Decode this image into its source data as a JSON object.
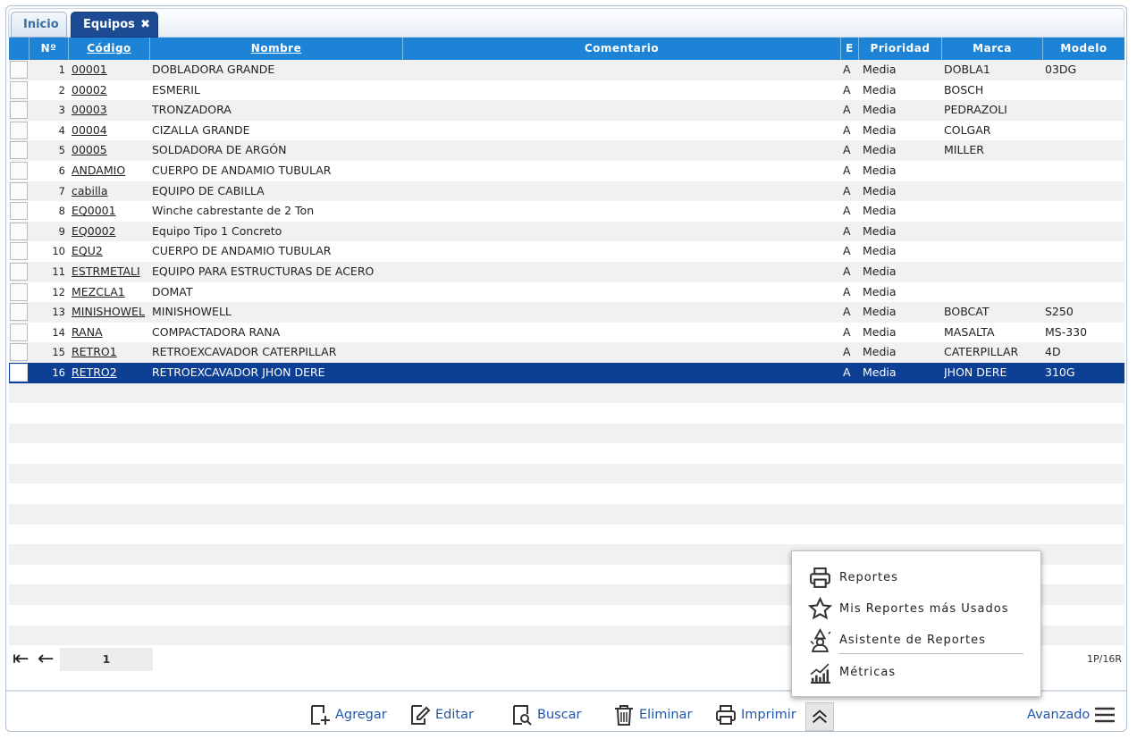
{
  "tabs": [
    {
      "label": "Inicio",
      "active": false
    },
    {
      "label": "Equipos",
      "active": true,
      "close": "✖"
    }
  ],
  "columns": {
    "no": "Nº",
    "codigo": "Código",
    "nombre": "Nombre",
    "comentario": "Comentario",
    "e": "E",
    "prioridad": "Prioridad",
    "marca": "Marca",
    "modelo": "Modelo"
  },
  "rows": [
    {
      "no": "1",
      "codigo": "00001",
      "nombre": "DOBLADORA GRANDE",
      "e": "A",
      "prioridad": "Media",
      "marca": "DOBLA1",
      "modelo": "03DG"
    },
    {
      "no": "2",
      "codigo": "00002",
      "nombre": "ESMERIL",
      "e": "A",
      "prioridad": "Media",
      "marca": "BOSCH",
      "modelo": ""
    },
    {
      "no": "3",
      "codigo": "00003",
      "nombre": "TRONZADORA",
      "e": "A",
      "prioridad": "Media",
      "marca": "PEDRAZOLI",
      "modelo": ""
    },
    {
      "no": "4",
      "codigo": "00004",
      "nombre": "CIZALLA GRANDE",
      "e": "A",
      "prioridad": "Media",
      "marca": "COLGAR",
      "modelo": ""
    },
    {
      "no": "5",
      "codigo": "00005",
      "nombre": "SOLDADORA DE ARGÓN",
      "e": "A",
      "prioridad": "Media",
      "marca": "MILLER",
      "modelo": ""
    },
    {
      "no": "6",
      "codigo": "ANDAMIO",
      "nombre": "CUERPO DE ANDAMIO TUBULAR",
      "e": "A",
      "prioridad": "Media",
      "marca": "",
      "modelo": ""
    },
    {
      "no": "7",
      "codigo": "cabilla",
      "nombre": "EQUIPO DE CABILLA",
      "e": "A",
      "prioridad": "Media",
      "marca": "",
      "modelo": ""
    },
    {
      "no": "8",
      "codigo": "EQ0001",
      "nombre": "Winche cabrestante de 2 Ton",
      "e": "A",
      "prioridad": "Media",
      "marca": "",
      "modelo": ""
    },
    {
      "no": "9",
      "codigo": "EQ0002",
      "nombre": "Equipo Tipo 1 Concreto",
      "e": "A",
      "prioridad": "Media",
      "marca": "",
      "modelo": ""
    },
    {
      "no": "10",
      "codigo": "EQU2",
      "nombre": "CUERPO DE ANDAMIO TUBULAR",
      "e": "A",
      "prioridad": "Media",
      "marca": "",
      "modelo": ""
    },
    {
      "no": "11",
      "codigo": "ESTRMETALI",
      "nombre": "EQUIPO PARA ESTRUCTURAS DE ACERO",
      "e": "A",
      "prioridad": "Media",
      "marca": "",
      "modelo": ""
    },
    {
      "no": "12",
      "codigo": "MEZCLA1",
      "nombre": "DOMAT",
      "e": "A",
      "prioridad": "Media",
      "marca": "",
      "modelo": ""
    },
    {
      "no": "13",
      "codigo": "MINISHOWEL",
      "nombre": "MINISHOWELL",
      "e": "A",
      "prioridad": "Media",
      "marca": "BOBCAT",
      "modelo": "S250"
    },
    {
      "no": "14",
      "codigo": "RANA",
      "nombre": "COMPACTADORA RANA",
      "e": "A",
      "prioridad": "Media",
      "marca": "MASALTA",
      "modelo": "MS-330"
    },
    {
      "no": "15",
      "codigo": "RETRO1",
      "nombre": "RETROEXCAVADOR CATERPILLAR",
      "e": "A",
      "prioridad": "Media",
      "marca": "CATERPILLAR",
      "modelo": "4D"
    },
    {
      "no": "16",
      "codigo": "RETRO2",
      "nombre": "RETROEXCAVADOR JHON DERE",
      "e": "A",
      "prioridad": "Media",
      "marca": "JHON DERE",
      "modelo": "310G",
      "selected": true
    }
  ],
  "pager": {
    "page": "1",
    "count": "1P/16R"
  },
  "toolbar": {
    "agregar": "Agregar",
    "editar": "Editar",
    "buscar": "Buscar",
    "eliminar": "Eliminar",
    "imprimir": "Imprimir",
    "avanzado": "Avanzado"
  },
  "print_menu": {
    "reportes": "Reportes",
    "mis_reportes": "Mis Reportes más Usados",
    "asistente": "Asistente de Reportes",
    "metricas": "Métricas"
  },
  "colors": {
    "header": "#1d83d6",
    "selected_row": "#0d3f94",
    "active_tab": "#1c4a93",
    "link": "#2356a8"
  }
}
